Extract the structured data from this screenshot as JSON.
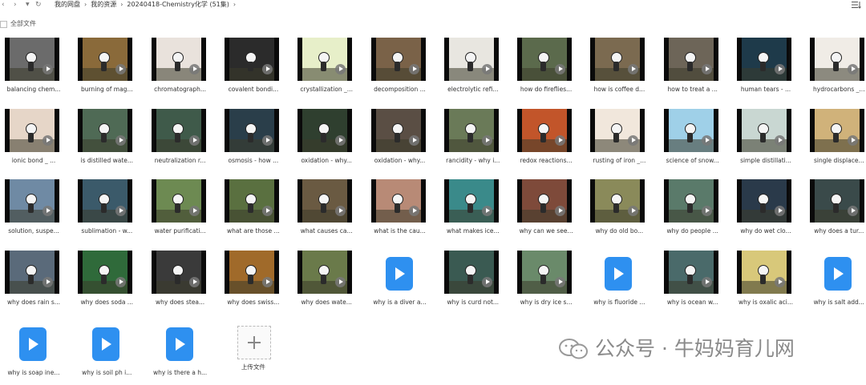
{
  "nav": {
    "back_icon": "chevron-left-icon",
    "forward_icon": "chevron-right-icon",
    "history_icon": "dropdown-icon",
    "refresh_icon": "refresh-icon"
  },
  "breadcrumb": {
    "items": [
      "我的网盘",
      "我的资源",
      "20240418-Chemistry化学 (51集)"
    ]
  },
  "toolbar": {
    "sort_icon": "list-sort-icon"
  },
  "select_all_label": "全部文件",
  "files": [
    {
      "name": "balancing chem...",
      "type": "video",
      "color": "#6b6b6b"
    },
    {
      "name": "burning of mag...",
      "type": "video",
      "color": "#8a6a3a"
    },
    {
      "name": "chromatograph...",
      "type": "video",
      "color": "#e9e2dc"
    },
    {
      "name": "covalent bondi...",
      "type": "video",
      "color": "#2b2b2b"
    },
    {
      "name": "crystallization _...",
      "type": "video",
      "color": "#e7efc9"
    },
    {
      "name": "decomposition ...",
      "type": "video",
      "color": "#7a6248"
    },
    {
      "name": "electrolytic refi...",
      "type": "video",
      "color": "#e8e6e0"
    },
    {
      "name": "how do fireflies...",
      "type": "video",
      "color": "#5b6a4c"
    },
    {
      "name": "how is coffee d...",
      "type": "video",
      "color": "#7b6a50"
    },
    {
      "name": "how to treat a ...",
      "type": "video",
      "color": "#6d6558"
    },
    {
      "name": "human tears - ...",
      "type": "video",
      "color": "#1e3a4a"
    },
    {
      "name": "hydrocarbons _...",
      "type": "video",
      "color": "#f0ece6"
    },
    {
      "name": "ionic bond _ ...",
      "type": "video",
      "color": "#e6d6c8"
    },
    {
      "name": "is distilled wate...",
      "type": "video",
      "color": "#4f6a55"
    },
    {
      "name": "neutralization r...",
      "type": "video",
      "color": "#3f5a4a"
    },
    {
      "name": "osmosis - how ...",
      "type": "video",
      "color": "#2a3e4a"
    },
    {
      "name": "oxidation - why...",
      "type": "video",
      "color": "#2f3f2f"
    },
    {
      "name": "oxidation - why...",
      "type": "video",
      "color": "#5a4e44"
    },
    {
      "name": "rancidity - why i...",
      "type": "video",
      "color": "#6a7a58"
    },
    {
      "name": "redox reactions...",
      "type": "video",
      "color": "#c2552a"
    },
    {
      "name": "rusting of iron _...",
      "type": "video",
      "color": "#f1e7dc"
    },
    {
      "name": "science of snow...",
      "type": "video",
      "color": "#9fd0e8"
    },
    {
      "name": "simple distillati...",
      "type": "video",
      "color": "#c9d7d2"
    },
    {
      "name": "single displace...",
      "type": "video",
      "color": "#d0b27a"
    },
    {
      "name": "solution, suspe...",
      "type": "video",
      "color": "#6f8aa4"
    },
    {
      "name": "sublimation - w...",
      "type": "video",
      "color": "#3b5a6a"
    },
    {
      "name": "water purificati...",
      "type": "video",
      "color": "#6d8a52"
    },
    {
      "name": "what are those ...",
      "type": "video",
      "color": "#5a7040"
    },
    {
      "name": "what causes ca...",
      "type": "video",
      "color": "#6a5a42"
    },
    {
      "name": "what is the cau...",
      "type": "video",
      "color": "#b88a76"
    },
    {
      "name": "what makes ice...",
      "type": "video",
      "color": "#3a8a8a"
    },
    {
      "name": "why can we see...",
      "type": "video",
      "color": "#7e4a3a"
    },
    {
      "name": "why do old bo...",
      "type": "video",
      "color": "#8a8a5a"
    },
    {
      "name": "why do people ...",
      "type": "video",
      "color": "#5a7a6a"
    },
    {
      "name": "why do wet clo...",
      "type": "video",
      "color": "#2a3a4a"
    },
    {
      "name": "why does a tur...",
      "type": "video",
      "color": "#3a4a4a"
    },
    {
      "name": "why does rain s...",
      "type": "video",
      "color": "#5a6a7a"
    },
    {
      "name": "why does soda ...",
      "type": "video",
      "color": "#2f6a3a"
    },
    {
      "name": "why does stea...",
      "type": "video",
      "color": "#3a3a3a"
    },
    {
      "name": "why does swiss...",
      "type": "video",
      "color": "#a06a2a"
    },
    {
      "name": "why does wate...",
      "type": "video",
      "color": "#6a7a4a"
    },
    {
      "name": "why is a diver a...",
      "type": "file",
      "color": "#2e90f0"
    },
    {
      "name": "why is curd not...",
      "type": "video",
      "color": "#3a5a52"
    },
    {
      "name": "why is dry ice s...",
      "type": "video",
      "color": "#6a8a6a"
    },
    {
      "name": "why is fluoride ...",
      "type": "file",
      "color": "#2e90f0"
    },
    {
      "name": "why is ocean w...",
      "type": "video",
      "color": "#4a6a6a"
    },
    {
      "name": "why is oxalic aci...",
      "type": "video",
      "color": "#d8c87a"
    },
    {
      "name": "why is salt add...",
      "type": "file",
      "color": "#2e90f0"
    },
    {
      "name": "why is soap ine...",
      "type": "file",
      "color": "#2e90f0"
    },
    {
      "name": "why is soil ph i...",
      "type": "file",
      "color": "#2e90f0"
    },
    {
      "name": "why is there a h...",
      "type": "file",
      "color": "#2e90f0"
    },
    {
      "name": "上传文件",
      "type": "upload",
      "color": "#bbbbbb"
    }
  ],
  "watermark": {
    "icon": "wechat-icon",
    "text": "公众号 · 牛妈妈育儿网"
  },
  "colors": {
    "accent": "#2e90f0",
    "background": "#ffffff"
  }
}
